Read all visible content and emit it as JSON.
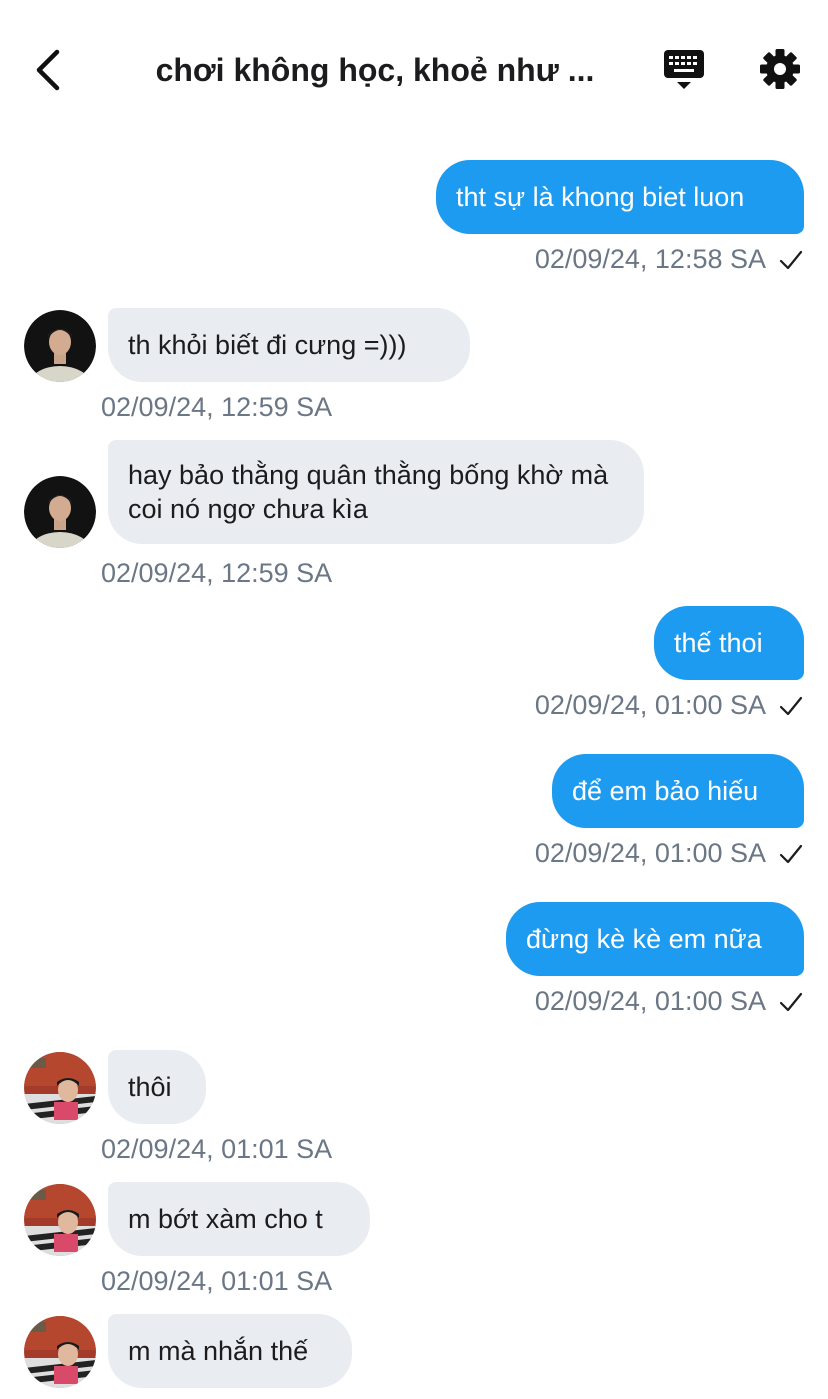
{
  "header": {
    "title": "chơi không học, khoẻ như ..."
  },
  "messages": [
    {
      "dir": "out",
      "text": "tht sự là khong biet luon",
      "time": "02/09/24, 12:58 SA"
    },
    {
      "dir": "in",
      "text": "th khỏi biết đi cưng =)))",
      "time": "02/09/24, 12:59 SA"
    },
    {
      "dir": "in",
      "text": "hay bảo thằng quân thằng bống khờ mà coi nó ngơ chưa kìa",
      "time": "02/09/24, 12:59 SA"
    },
    {
      "dir": "out",
      "text": "thế thoi",
      "time": "02/09/24, 01:00 SA"
    },
    {
      "dir": "out",
      "text": "để em bảo hiếu",
      "time": "02/09/24, 01:00 SA"
    },
    {
      "dir": "out",
      "text": "đừng kè kè em nữa",
      "time": "02/09/24, 01:00 SA"
    },
    {
      "dir": "in",
      "text": "thôi",
      "time": "02/09/24, 01:01 SA"
    },
    {
      "dir": "in",
      "text": "m bớt xàm cho t",
      "time": "02/09/24, 01:01 SA"
    },
    {
      "dir": "in",
      "text": "m mà nhắn thế",
      "time": ""
    }
  ],
  "colors": {
    "outgoing_bubble": "#1d9bf0",
    "incoming_bubble": "#e9edf1",
    "timestamp": "#6b7785"
  },
  "icons": {
    "back": "chevron-left-icon",
    "keyboard": "keyboard-icon",
    "settings": "gear-icon",
    "read": "checkmark-icon"
  }
}
